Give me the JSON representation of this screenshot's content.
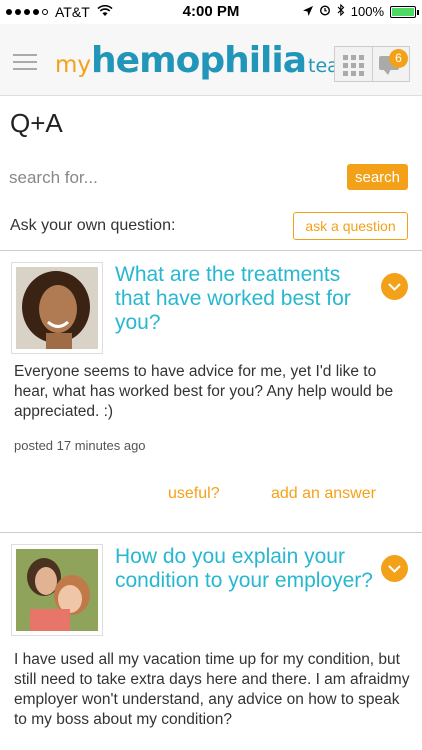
{
  "status_bar": {
    "carrier": "AT&T",
    "time": "4:00 PM",
    "battery": "100%"
  },
  "header": {
    "logo": {
      "prefix": "my",
      "main": "hemophilia",
      "suffix": "team"
    },
    "notification_count": "6"
  },
  "page": {
    "title": "Q+A"
  },
  "search": {
    "placeholder": "search for...",
    "value": "",
    "button_label": "search"
  },
  "ask": {
    "label": "Ask your own question:",
    "button_label": "ask a question"
  },
  "questions": [
    {
      "title": "What are the treatments that have worked best for you?",
      "body": "Everyone seems to have advice for me, yet I'd like to hear, what has worked best for you? Any help would be appreciated. :)",
      "posted": "posted 17 minutes ago",
      "useful_label": "useful?",
      "answer_label": "add an answer"
    },
    {
      "title": "How do you explain your condition to your employer?",
      "body": "I have used all my vacation time up for my condition, but still need to take extra days here and there.  I am afraidmy employer won't understand, any advice on how to speak to my boss about my condition?"
    }
  ],
  "colors": {
    "accent": "#f4a11a",
    "link": "#27b8d0",
    "brand": "#2196b8"
  }
}
